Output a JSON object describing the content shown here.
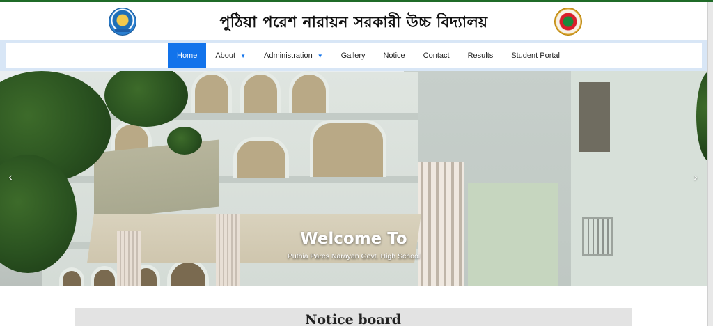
{
  "header": {
    "title": "পুঠিয়া পরেশ নারায়ন সরকারী উচ্চ বিদ্যালয়",
    "left_logo_icon": "school-emblem-icon",
    "right_logo_icon": "government-seal-icon"
  },
  "nav": {
    "items": [
      {
        "label": "Home",
        "active": true
      },
      {
        "label": "About",
        "dropdown": true
      },
      {
        "label": "Administration",
        "dropdown": true
      },
      {
        "label": "Gallery"
      },
      {
        "label": "Notice"
      },
      {
        "label": "Contact"
      },
      {
        "label": "Results"
      },
      {
        "label": "Student Portal"
      }
    ],
    "caret_glyph": "▼",
    "accent_color": "#1273eb"
  },
  "hero": {
    "title": "Welcome To",
    "subtitle": "Puthia Pares Narayan Govt. High School",
    "prev_glyph": "‹",
    "next_glyph": "›"
  },
  "notice_board": {
    "title": "Notice board"
  }
}
